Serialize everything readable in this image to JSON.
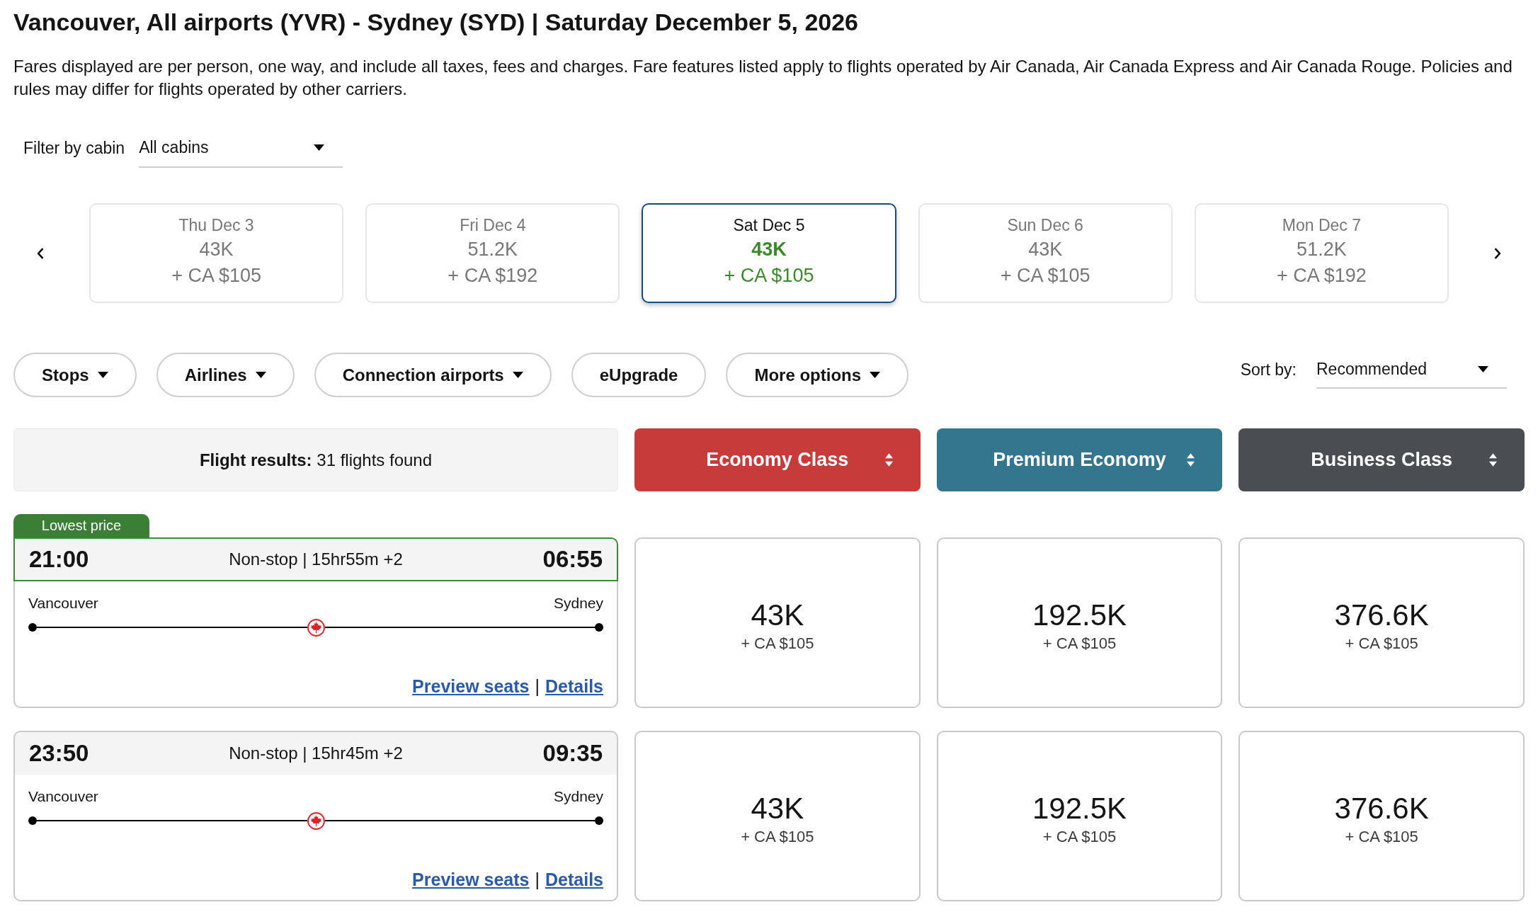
{
  "header": {
    "title": "Vancouver, All airports (YVR) - Sydney (SYD) | Saturday December 5, 2026",
    "description": "Fares displayed are per person, one way, and include all taxes, fees and charges. Fare features listed apply to flights operated by Air Canada, Air Canada Express and Air Canada Rouge. Policies and rules may differ for flights operated by other carriers."
  },
  "cabin_filter": {
    "label": "Filter by cabin",
    "value": "All cabins"
  },
  "date_carousel": {
    "days": [
      {
        "date": "Thu Dec 3",
        "points": "43K",
        "cash": "+ CA $105",
        "selected": false
      },
      {
        "date": "Fri Dec 4",
        "points": "51.2K",
        "cash": "+ CA $192",
        "selected": false
      },
      {
        "date": "Sat Dec 5",
        "points": "43K",
        "cash": "+ CA $105",
        "selected": true
      },
      {
        "date": "Sun Dec 6",
        "points": "43K",
        "cash": "+ CA $105",
        "selected": false
      },
      {
        "date": "Mon Dec 7",
        "points": "51.2K",
        "cash": "+ CA $192",
        "selected": false
      }
    ]
  },
  "filters": [
    {
      "label": "Stops",
      "has_menu": true
    },
    {
      "label": "Airlines",
      "has_menu": true
    },
    {
      "label": "Connection airports",
      "has_menu": true
    },
    {
      "label": "eUpgrade",
      "has_menu": false
    },
    {
      "label": "More options",
      "has_menu": true
    }
  ],
  "sort": {
    "label": "Sort by:",
    "value": "Recommended"
  },
  "results": {
    "summary": "**Flight results:** 31 flights found"
  },
  "cabins": [
    {
      "name": "Economy Class",
      "color": "#c73c3a"
    },
    {
      "name": "Premium Economy",
      "color": "#33768e"
    },
    {
      "name": "Business Class",
      "color": "#4a4d52"
    }
  ],
  "flights": [
    {
      "badge": "Lowest price",
      "departure": "21:00",
      "summary": "Non-stop | 15hr55m +2",
      "arrival": "06:55",
      "origin": "Vancouver",
      "destination": "Sydney",
      "links": [
        "Preview seats",
        "Details"
      ],
      "link_separator": "|",
      "fares": [
        {
          "points": "43K",
          "cash": "+ CA $105"
        },
        {
          "points": "192.5K",
          "cash": "+ CA $105"
        },
        {
          "points": "376.6K",
          "cash": "+ CA $105"
        }
      ]
    },
    {
      "departure": "23:50",
      "summary": "Non-stop | 15hr45m +2",
      "arrival": "09:35",
      "origin": "Vancouver",
      "destination": "Sydney",
      "links": [
        "Preview seats",
        "Details"
      ],
      "link_separator": "|",
      "fares": [
        {
          "points": "43K",
          "cash": "+ CA $105"
        },
        {
          "points": "192.5K",
          "cash": "+ CA $105"
        },
        {
          "points": "376.6K",
          "cash": "+ CA $105"
        }
      ]
    }
  ]
}
